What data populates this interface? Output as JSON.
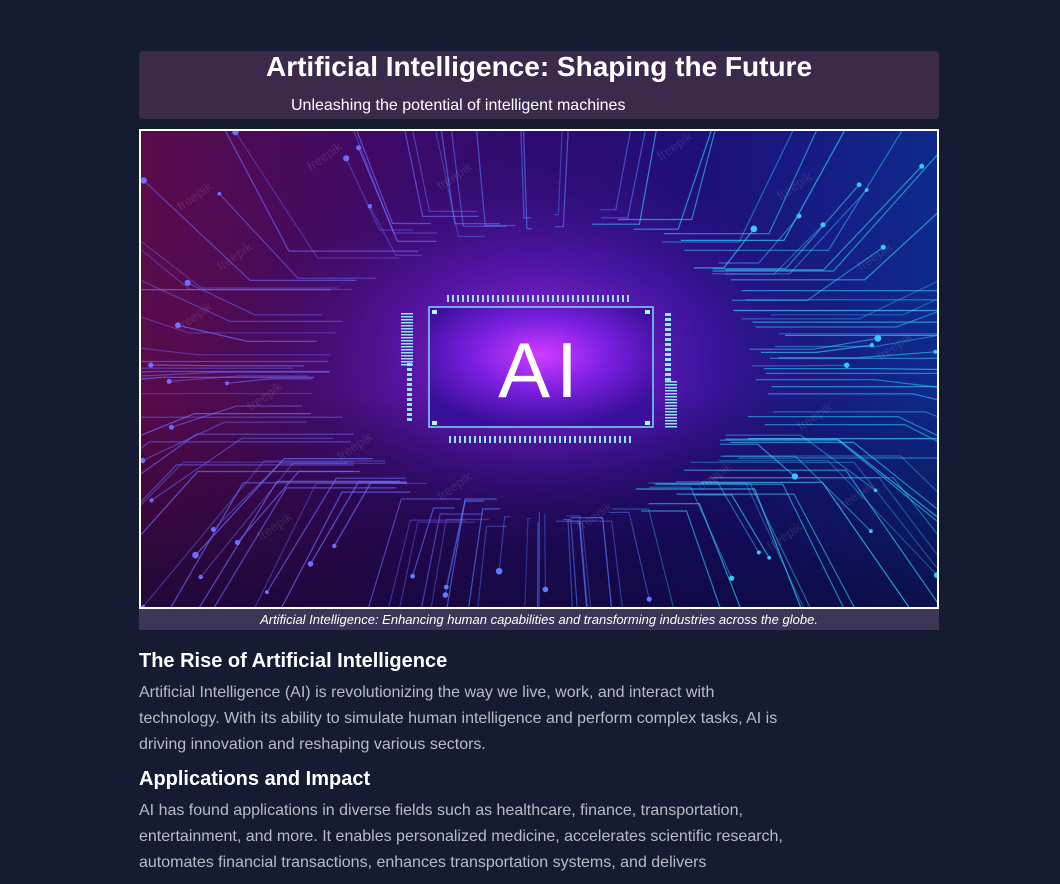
{
  "header": {
    "title": "Artificial Intelligence: Shaping the Future",
    "subtitle": "Unleashing the potential of intelligent machines"
  },
  "banner": {
    "chip_text": "AI",
    "watermark": "freepik",
    "caption": "Artificial Intelligence: Enhancing human capabilities and transforming industries across the globe."
  },
  "sections": [
    {
      "heading": "The Rise of Artificial Intelligence",
      "body": "Artificial Intelligence (AI) is revolutionizing the way we live, work, and interact with technology. With its ability to simulate human intelligence and perform complex tasks, AI is driving innovation and reshaping various sectors."
    },
    {
      "heading": "Applications and Impact",
      "body": "AI has found applications in diverse fields such as healthcare, finance, transportation, entertainment, and more. It enables personalized medicine, accelerates scientific research, automates financial transactions, enhances transportation systems, and delivers"
    }
  ],
  "colors": {
    "background": "#151b33",
    "header_bg": "#3c2a4d",
    "caption_bg": "#3c3557",
    "body_text": "#b7bcc8"
  }
}
